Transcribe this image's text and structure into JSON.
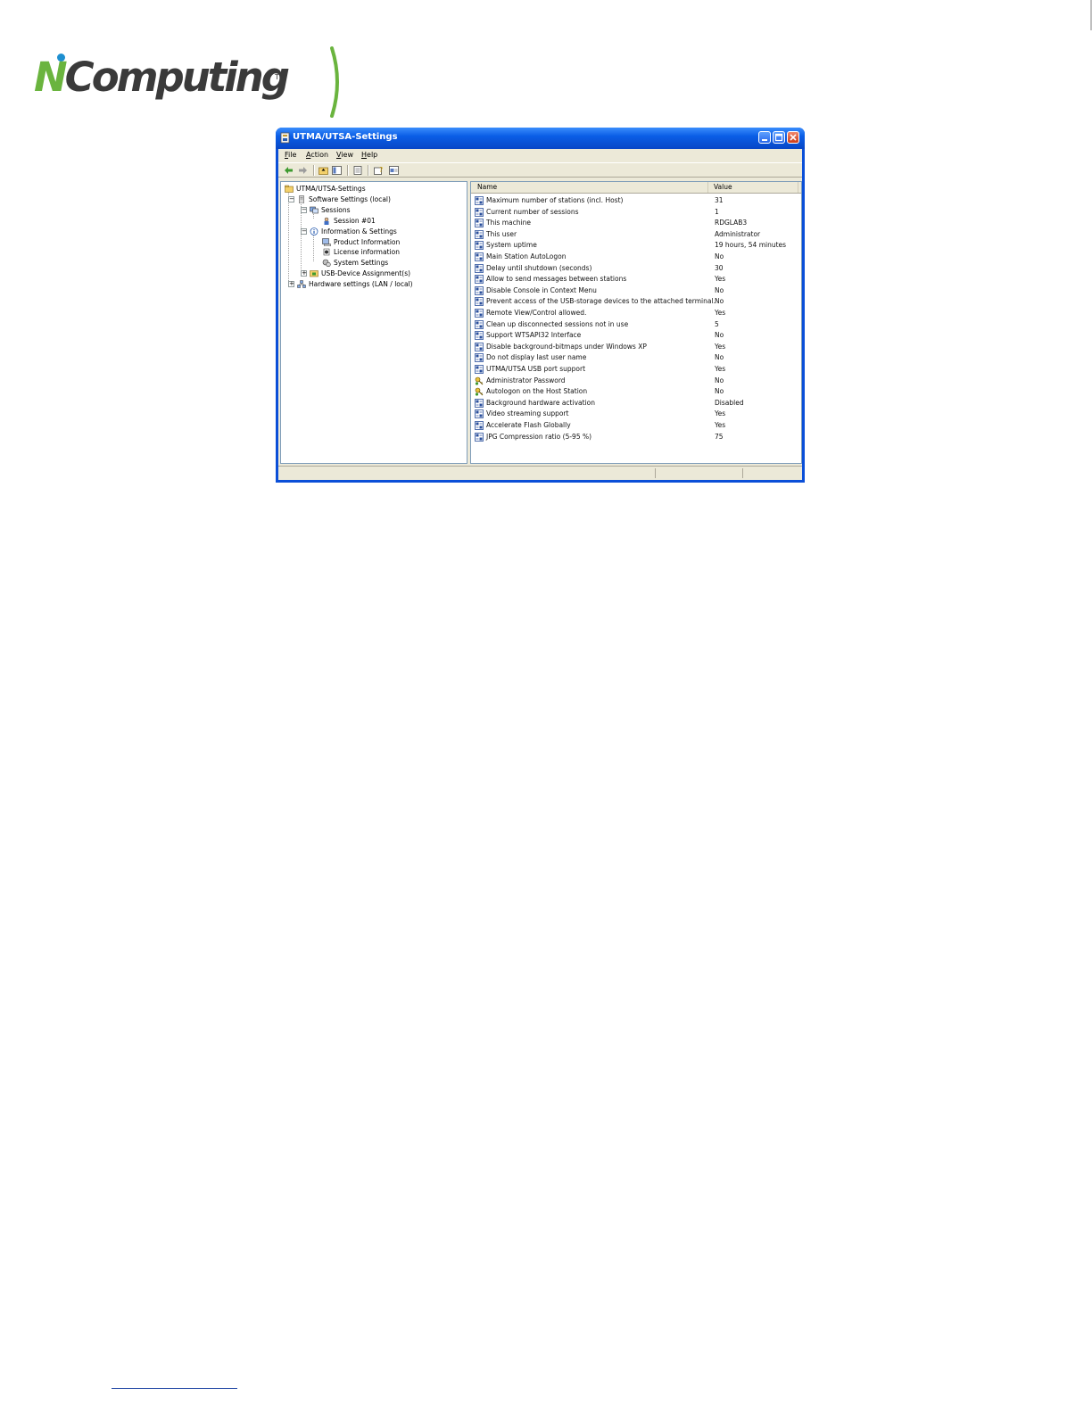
{
  "header": {
    "logo_text": "NComputing",
    "logo_tm": "TM"
  },
  "window": {
    "title": "UTMA/UTSA-Settings",
    "menu": [
      "File",
      "Action",
      "View",
      "Help"
    ],
    "menu_underline": [
      "F",
      "A",
      "V",
      "H"
    ],
    "toolbar_icons": [
      "back-arrow-icon",
      "forward-arrow-icon",
      "up-folder-icon",
      "show-hide-tree-icon",
      "export-list-icon",
      "help-icon",
      "properties-icon"
    ]
  },
  "tree": [
    {
      "label": "UTMA/UTSA-Settings",
      "icon": "folder-icon",
      "level": 0
    },
    {
      "label": "Software Settings (local)",
      "icon": "server-icon",
      "level": 1,
      "expander": "−"
    },
    {
      "label": "Sessions",
      "icon": "sessions-icon",
      "level": 2,
      "expander": "−"
    },
    {
      "label": "Session #01",
      "icon": "session-icon",
      "level": 3
    },
    {
      "label": "Information & Settings",
      "icon": "info-icon",
      "level": 2,
      "expander": "−"
    },
    {
      "label": "Product Information",
      "icon": "product-icon",
      "level": 3
    },
    {
      "label": "License information",
      "icon": "license-icon",
      "level": 3
    },
    {
      "label": "System Settings",
      "icon": "settings-icon",
      "level": 3
    },
    {
      "label": "USB-Device Assignment(s)",
      "icon": "usb-icon",
      "level": 2,
      "expander": "+"
    },
    {
      "label": "Hardware settings (LAN / local)",
      "icon": "network-icon",
      "level": 1,
      "expander": "+"
    }
  ],
  "list": {
    "columns": [
      "Name",
      "Value"
    ],
    "rows": [
      {
        "name": "Maximum number of stations (incl. Host)",
        "value": "31",
        "icon": "setting-icon"
      },
      {
        "name": "Current number of sessions",
        "value": "1",
        "icon": "setting-icon"
      },
      {
        "name": "This machine",
        "value": "RDGLAB3",
        "icon": "setting-icon"
      },
      {
        "name": "This user",
        "value": "Administrator",
        "icon": "setting-icon"
      },
      {
        "name": "System uptime",
        "value": "19 hours, 54 minutes",
        "icon": "setting-icon"
      },
      {
        "name": "Main Station AutoLogon",
        "value": "No",
        "icon": "setting-icon"
      },
      {
        "name": "Delay until shutdown (seconds)",
        "value": "30",
        "icon": "setting-icon"
      },
      {
        "name": "Allow to send messages between stations",
        "value": "Yes",
        "icon": "setting-icon"
      },
      {
        "name": "Disable Console in Context Menu",
        "value": "No",
        "icon": "setting-icon"
      },
      {
        "name": "Prevent access of the USB-storage devices to the attached terminal.",
        "value": "No",
        "icon": "setting-icon"
      },
      {
        "name": "Remote View/Control allowed.",
        "value": "Yes",
        "icon": "setting-icon"
      },
      {
        "name": "Clean up disconnected sessions not in use",
        "value": "5",
        "icon": "setting-icon"
      },
      {
        "name": "Support WTSAPI32 Interface",
        "value": "No",
        "icon": "setting-icon"
      },
      {
        "name": "Disable background-bitmaps under Windows XP",
        "value": "Yes",
        "icon": "setting-icon"
      },
      {
        "name": "Do not display last user name",
        "value": "No",
        "icon": "setting-icon"
      },
      {
        "name": "UTMA/UTSA USB port support",
        "value": "Yes",
        "icon": "setting-icon"
      },
      {
        "name": "Administrator Password",
        "value": "No",
        "icon": "password-key-icon"
      },
      {
        "name": "Autologon on the Host Station",
        "value": "No",
        "icon": "password-key-icon"
      },
      {
        "name": "Background hardware activation",
        "value": "Disabled",
        "icon": "setting-icon"
      },
      {
        "name": "Video streaming support",
        "value": "Yes",
        "icon": "setting-icon"
      },
      {
        "name": "Accelerate Flash Globally",
        "value": "Yes",
        "icon": "setting-icon"
      },
      {
        "name": "JPG Compression ratio (5-95 %)",
        "value": "75",
        "icon": "setting-icon"
      }
    ]
  },
  "colors": {
    "titlebar": "#0a5ee6",
    "logo_green": "#6ab43e",
    "logo_dot": "#1e8fd0"
  }
}
